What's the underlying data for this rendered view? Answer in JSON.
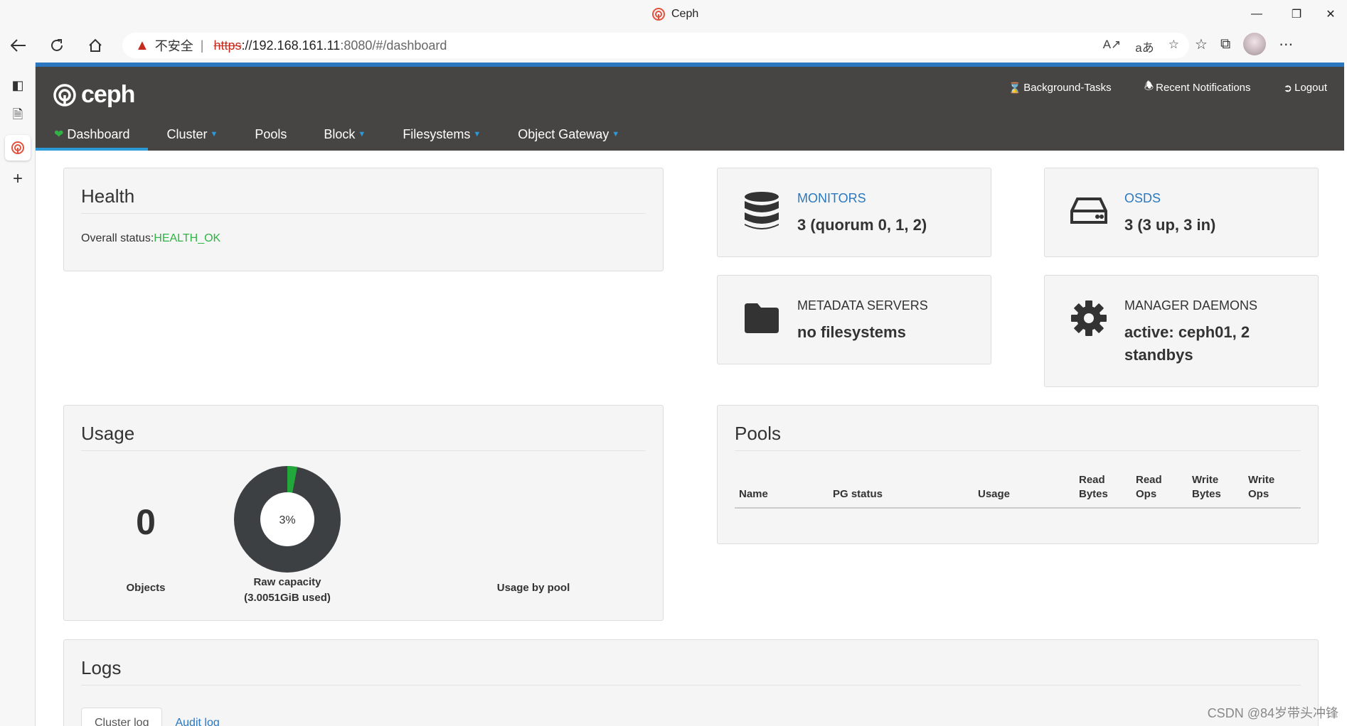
{
  "browser": {
    "tab_title": "Ceph",
    "security_label": "不安全",
    "url_scheme": "https",
    "url_host": "://192.168.161.11",
    "url_path": ":8080/#/dashboard"
  },
  "app": {
    "logo_text": "ceph",
    "top_links": {
      "background_tasks": "Background-Tasks",
      "notifications": "Recent Notifications",
      "logout": "Logout"
    },
    "menu": [
      {
        "label": "Dashboard",
        "active": true
      },
      {
        "label": "Cluster",
        "dropdown": true
      },
      {
        "label": "Pools"
      },
      {
        "label": "Block",
        "dropdown": true
      },
      {
        "label": "Filesystems",
        "dropdown": true
      },
      {
        "label": "Object Gateway",
        "dropdown": true
      }
    ]
  },
  "health": {
    "title": "Health",
    "overall_label": "Overall status:",
    "overall_value": "HEALTH_OK"
  },
  "monitors": {
    "label": "MONITORS",
    "value": "3 (quorum 0, 1, 2)"
  },
  "osds": {
    "label": "OSDS",
    "value": "3 (3 up, 3 in)"
  },
  "mds": {
    "label": "METADATA SERVERS",
    "value": "no filesystems"
  },
  "mgr": {
    "label": "MANAGER DAEMONS",
    "value_line1": "active: ceph01, 2",
    "value_line2": "standbys"
  },
  "usage": {
    "title": "Usage",
    "objects_value": "0",
    "objects_label": "Objects",
    "raw_percent": 3,
    "raw_percent_text": "3%",
    "raw_label_line1": "Raw capacity",
    "raw_label_line2": "(3.0051GiB used)",
    "pool_label": "Usage by pool"
  },
  "pools": {
    "title": "Pools",
    "columns": {
      "name": "Name",
      "pg_status": "PG status",
      "usage": "Usage",
      "read_bytes_1": "Read",
      "read_bytes_2": "Bytes",
      "read_ops_1": "Read",
      "read_ops_2": "Ops",
      "write_bytes_1": "Write",
      "write_bytes_2": "Bytes",
      "write_ops_1": "Write",
      "write_ops_2": "Ops"
    }
  },
  "logs": {
    "title": "Logs",
    "tab_cluster": "Cluster log",
    "tab_audit": "Audit log"
  },
  "watermark": "CSDN @84岁带头冲锋",
  "colors": {
    "accent": "#2b78c0",
    "ok": "#2fb344",
    "navbar": "#474544",
    "donut": "#3c4043"
  }
}
